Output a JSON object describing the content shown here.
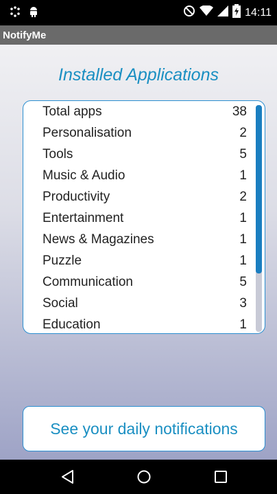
{
  "status_bar": {
    "time": "14:11",
    "icons": [
      "notification-dots-icon",
      "android-icon",
      "do-not-disturb-icon",
      "wifi-icon",
      "signal-icon",
      "battery-charging-icon"
    ]
  },
  "app_bar": {
    "title": "NotifyMe"
  },
  "main": {
    "heading": "Installed Applications",
    "categories": [
      {
        "label": "Total apps",
        "count": "38"
      },
      {
        "label": "Personalisation",
        "count": "2"
      },
      {
        "label": "Tools",
        "count": "5"
      },
      {
        "label": "Music & Audio",
        "count": "1"
      },
      {
        "label": "Productivity",
        "count": "2"
      },
      {
        "label": "Entertainment",
        "count": "1"
      },
      {
        "label": "News & Magazines",
        "count": "1"
      },
      {
        "label": "Puzzle",
        "count": "1"
      },
      {
        "label": "Communication",
        "count": "5"
      },
      {
        "label": "Social",
        "count": "3"
      },
      {
        "label": "Education",
        "count": "1"
      }
    ],
    "notifications_button": "See your daily notifications"
  },
  "nav_bar": {
    "icons": [
      "back-icon",
      "home-icon",
      "recents-icon"
    ]
  },
  "colors": {
    "accent": "#1a8fc2",
    "border": "#2a8ed0",
    "app_bar": "#6a6a6a"
  }
}
